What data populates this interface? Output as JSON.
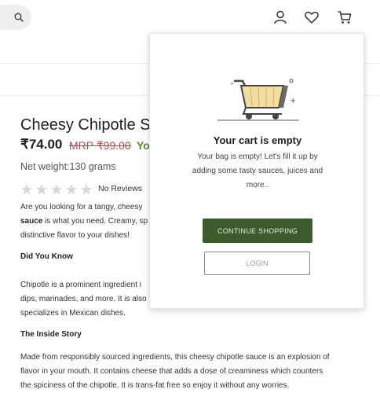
{
  "header": {
    "icons": [
      "search-icon",
      "user-icon",
      "heart-icon",
      "cart-icon"
    ]
  },
  "product": {
    "title": "Cheesy Chipotle S",
    "price": "₹74.00",
    "mrp": "MRP ₹99.00",
    "you_save": "Yo",
    "net_weight": "Net weight:130 grams",
    "rating": 0,
    "rating_max": 5,
    "reviews": "No Reviews",
    "intro_line1": "Are you looking for a tangy, cheesy",
    "intro_line2_bold": "sauce",
    "intro_line2_rest": " is what you need. Creamy, sp",
    "intro_line3": "distinctive flavor to your dishes!",
    "did_you_know_heading": "Did You Know",
    "dyk_line1": "Chipotle is a prominent ingredient i",
    "dyk_line2": "dips, marinades, and more. It is also",
    "dyk_line3": "specializes in Mexican dishes.",
    "inside_story_heading": "The Inside Story",
    "story_line1": "Made from responsibly sourced ingredients, this cheesy chipotle sauce is an explosion of",
    "story_line2": "flavor in your mouth. It contains cheese that adds a dose of creaminess which counters",
    "story_line3": "the spiciness of the chipotle. It is trans-fat free so enjoy it without any worries."
  },
  "cart": {
    "title": "Your cart is empty",
    "message": "Your bag is empty! Let's fill it up by adding some tasty sauces, juices and more..",
    "continue_label": "CONTINUE SHOPPING",
    "login_label": "LOGIN"
  },
  "colors": {
    "accent_green": "#3c5a2c",
    "price_strike": "#c14545",
    "save_green": "#5a8a2a"
  }
}
